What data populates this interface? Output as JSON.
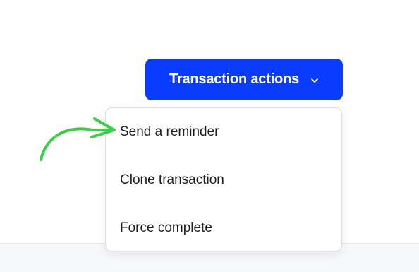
{
  "toolbar": {
    "actions_label": "Transaction actions",
    "chevron_icon": "chevron-down-icon"
  },
  "menu": {
    "items": [
      {
        "label": "Send a reminder"
      },
      {
        "label": "Clone transaction"
      },
      {
        "label": "Force complete"
      }
    ]
  },
  "annotation": {
    "arrow_icon": "curved-arrow-icon",
    "arrow_color": "#3ccd49"
  },
  "colors": {
    "accent": "#0a3cff",
    "text": "#1a1d24",
    "menu_border": "#dcdfe4"
  }
}
